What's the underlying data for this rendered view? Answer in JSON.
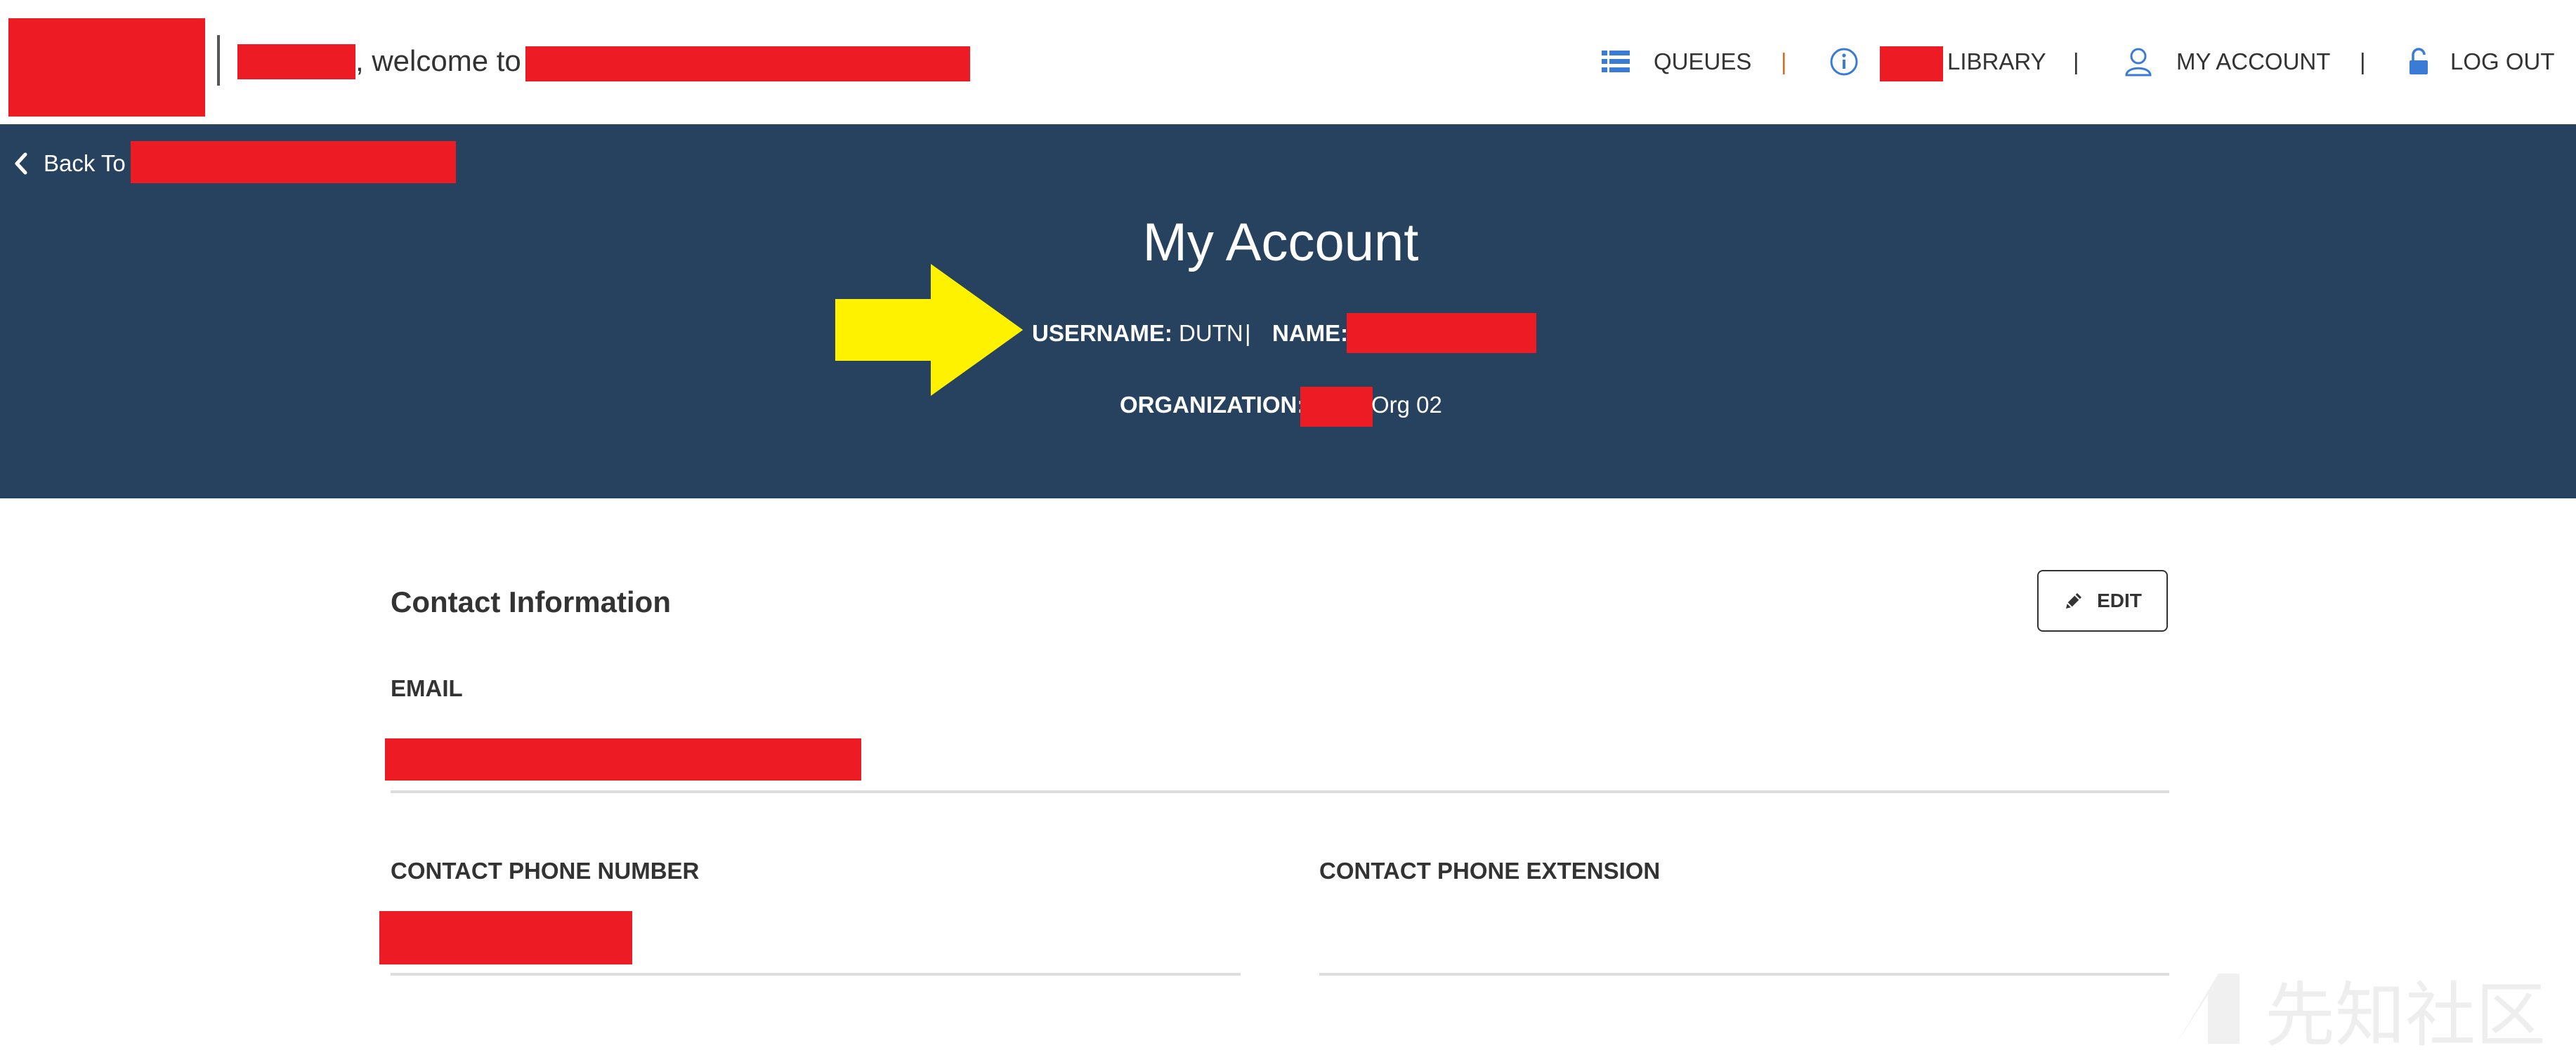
{
  "header": {
    "welcome_text": ", welcome to",
    "nav": {
      "queues_label": "QUEUES",
      "library_label": "LIBRARY",
      "my_account_label": "MY ACCOUNT",
      "log_out_label": "LOG OUT",
      "separator": "|"
    },
    "icons": {
      "queues": "list-icon",
      "library": "info-icon",
      "my_account": "user-icon",
      "log_out": "unlock-icon"
    }
  },
  "banner": {
    "back_label": "Back To",
    "title": "My Account",
    "username_label": "USERNAME:",
    "username_value": "DUTN",
    "separator": "|",
    "name_label": "NAME:",
    "organization_label": "ORGANIZATION:",
    "organization_suffix": "Org 02"
  },
  "contact": {
    "title": "Contact Information",
    "edit_label": "EDIT",
    "email_label": "EMAIL",
    "phone_label": "CONTACT PHONE NUMBER",
    "extension_label": "CONTACT PHONE EXTENSION",
    "email_value": "",
    "phone_value": "",
    "extension_value": ""
  },
  "watermark": {
    "text": "先知社区"
  },
  "colors": {
    "banner_bg": "#27425f",
    "redaction": "#ed1c24",
    "arrow": "#fff200",
    "nav_icon": "#3a7bd5",
    "text": "#333333"
  }
}
